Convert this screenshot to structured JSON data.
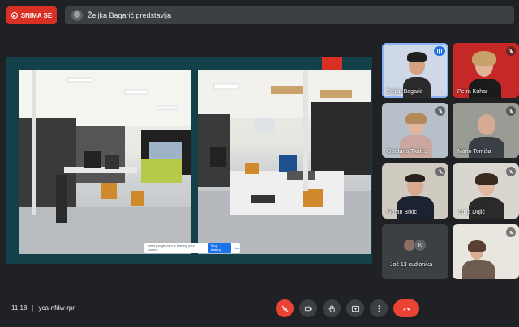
{
  "recording": {
    "label": "SNIMA SE"
  },
  "presenting": {
    "text": "Željka Bagarić predstavlja"
  },
  "share_bar": {
    "text": "meet.google.com is sharing your screen.",
    "stop": "Stop sharing",
    "hide": "Hide"
  },
  "participants": [
    {
      "name": "Željka Bagarić",
      "muted": false,
      "speaking": true
    },
    {
      "name": "Petra Kuhar",
      "muted": true
    },
    {
      "name": "Gordana Tkalec",
      "muted": true
    },
    {
      "name": "Mario Tomiša",
      "muted": true
    },
    {
      "name": "Goran Brkic",
      "muted": true
    },
    {
      "name": "Lidija Dujić",
      "muted": true
    },
    {
      "name": "",
      "muted": true
    }
  ],
  "more_tile": {
    "label": "Još 13 sudionika",
    "avatar_letter": "K"
  },
  "footer": {
    "time": "11:18",
    "separator": "|",
    "meeting_code": "yca-nfdw-rpr"
  },
  "controls": [
    "mic-off-icon",
    "camera-icon",
    "raise-hand-icon",
    "present-icon",
    "more-options-icon",
    "hang-up-icon"
  ],
  "colors": {
    "accent": "#8ab4f8",
    "record": "#d93025",
    "hangup": "#ea4335",
    "stage_bg": "#14404a"
  }
}
